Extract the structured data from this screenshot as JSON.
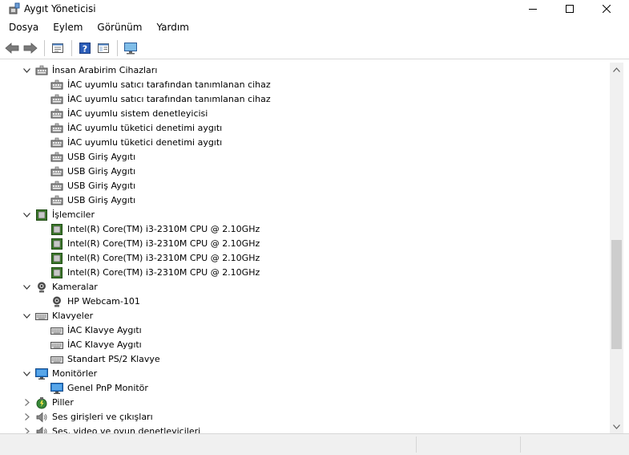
{
  "window": {
    "title": "Aygıt Yöneticisi",
    "icon": "device-manager-icon"
  },
  "menu": {
    "items": [
      {
        "label": "Dosya"
      },
      {
        "label": "Eylem"
      },
      {
        "label": "Görünüm"
      },
      {
        "label": "Yardım"
      }
    ]
  },
  "toolbar": {
    "buttons": [
      "back-icon",
      "forward-icon",
      "properties-icon",
      "help-icon",
      "toggle-pane-icon",
      "monitor-scan-icon"
    ]
  },
  "tree": {
    "rows": [
      {
        "level": 1,
        "expanded": true,
        "icon": "hid-icon",
        "label": "İnsan Arabirim Cihazları"
      },
      {
        "level": 2,
        "icon": "hid-icon",
        "label": "İAC uyumlu satıcı tarafından tanımlanan cihaz"
      },
      {
        "level": 2,
        "icon": "hid-icon",
        "label": "İAC uyumlu satıcı tarafından tanımlanan cihaz"
      },
      {
        "level": 2,
        "icon": "hid-icon",
        "label": "İAC uyumlu sistem denetleyicisi"
      },
      {
        "level": 2,
        "icon": "hid-icon",
        "label": "İAC uyumlu tüketici denetimi aygıtı"
      },
      {
        "level": 2,
        "icon": "hid-icon",
        "label": "İAC uyumlu tüketici denetimi aygıtı"
      },
      {
        "level": 2,
        "icon": "hid-icon",
        "label": "USB Giriş Aygıtı"
      },
      {
        "level": 2,
        "icon": "hid-icon",
        "label": "USB Giriş Aygıtı"
      },
      {
        "level": 2,
        "icon": "hid-icon",
        "label": "USB Giriş Aygıtı"
      },
      {
        "level": 2,
        "icon": "hid-icon",
        "label": "USB Giriş Aygıtı"
      },
      {
        "level": 1,
        "expanded": true,
        "icon": "processor-icon",
        "label": "İşlemciler"
      },
      {
        "level": 2,
        "icon": "processor-icon",
        "label": "Intel(R) Core(TM) i3-2310M CPU @ 2.10GHz"
      },
      {
        "level": 2,
        "icon": "processor-icon",
        "label": "Intel(R) Core(TM) i3-2310M CPU @ 2.10GHz"
      },
      {
        "level": 2,
        "icon": "processor-icon",
        "label": "Intel(R) Core(TM) i3-2310M CPU @ 2.10GHz"
      },
      {
        "level": 2,
        "icon": "processor-icon",
        "label": "Intel(R) Core(TM) i3-2310M CPU @ 2.10GHz"
      },
      {
        "level": 1,
        "expanded": true,
        "icon": "camera-icon",
        "label": "Kameralar"
      },
      {
        "level": 2,
        "icon": "camera-icon",
        "label": "HP Webcam-101"
      },
      {
        "level": 1,
        "expanded": true,
        "icon": "keyboard-icon",
        "label": "Klavyeler"
      },
      {
        "level": 2,
        "icon": "keyboard-icon",
        "label": "İAC Klavye Aygıtı"
      },
      {
        "level": 2,
        "icon": "keyboard-icon",
        "label": "İAC Klavye Aygıtı"
      },
      {
        "level": 2,
        "icon": "keyboard-icon",
        "label": "Standart PS/2 Klavye"
      },
      {
        "level": 1,
        "expanded": true,
        "icon": "monitor-icon",
        "label": "Monitörler"
      },
      {
        "level": 2,
        "icon": "monitor-icon",
        "label": "Genel PnP Monitör"
      },
      {
        "level": 1,
        "expanded": false,
        "icon": "battery-icon",
        "label": "Piller"
      },
      {
        "level": 1,
        "expanded": false,
        "icon": "speaker-icon",
        "label": "Ses girişleri ve çıkışları"
      },
      {
        "level": 1,
        "expanded": false,
        "icon": "speaker-icon",
        "label": "Ses, video ve oyun denetleyicileri"
      }
    ]
  },
  "scrollbar": {
    "position_fraction": 0.7
  },
  "colors": {
    "accent": "#0078d7",
    "processor_green": "#3c7a2a",
    "monitor_blue": "#2a7fd4"
  }
}
